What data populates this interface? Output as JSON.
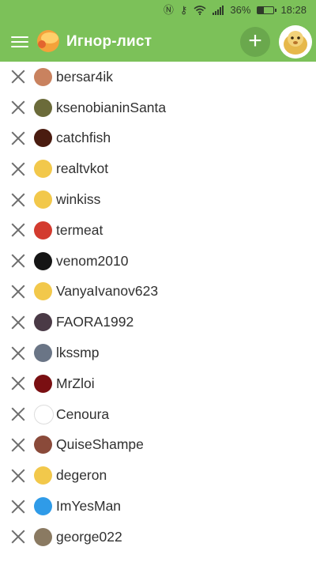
{
  "status": {
    "battery": "36%",
    "time": "18:28"
  },
  "toolbar": {
    "title": "Игнор-лист",
    "add_label": "+"
  },
  "ignore_list": [
    {
      "name": "bersar4ik",
      "avatar_color": "#c9825f"
    },
    {
      "name": "ksenobianinSanta",
      "avatar_color": "#6b6b3a"
    },
    {
      "name": "catchfish",
      "avatar_color": "#4a1c10"
    },
    {
      "name": "realtvkot",
      "avatar_color": "#f2c84b"
    },
    {
      "name": "winkiss",
      "avatar_color": "#f2c84b"
    },
    {
      "name": "termeat",
      "avatar_color": "#d33b2f"
    },
    {
      "name": "venom2010",
      "avatar_color": "#151515"
    },
    {
      "name": "VanyaIvanov623",
      "avatar_color": "#f2c84b"
    },
    {
      "name": "FAORA1992",
      "avatar_color": "#4a3a46"
    },
    {
      "name": "lkssmp",
      "avatar_color": "#6a7586"
    },
    {
      "name": "MrZloi",
      "avatar_color": "#7a0f12"
    },
    {
      "name": "Cenoura",
      "avatar_color": "#ffffff"
    },
    {
      "name": "QuiseShampe",
      "avatar_color": "#8a4a3a"
    },
    {
      "name": "degeron",
      "avatar_color": "#f2c84b"
    },
    {
      "name": "ImYesMan",
      "avatar_color": "#2f9be8"
    },
    {
      "name": "george022",
      "avatar_color": "#8a7a62"
    }
  ]
}
